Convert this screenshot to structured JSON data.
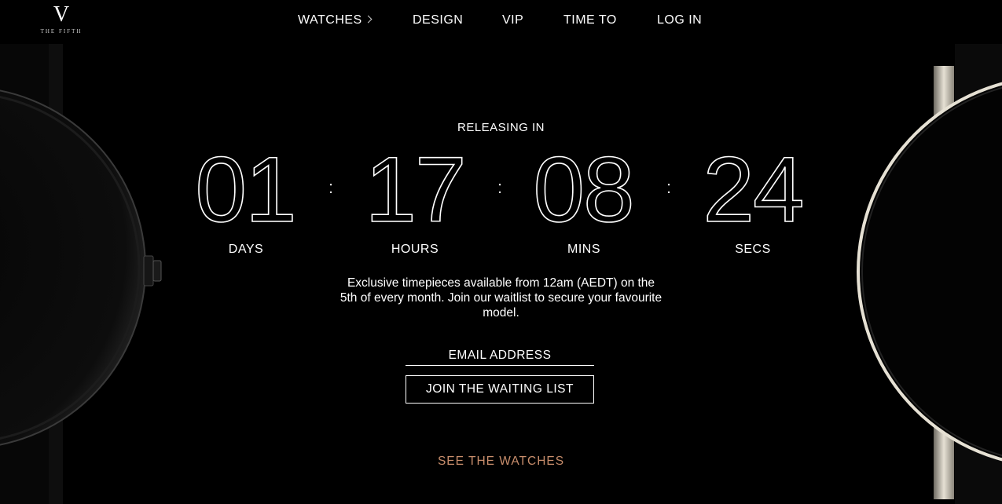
{
  "brand": {
    "logo_mark": "V",
    "logo_text": "THE FIFTH"
  },
  "nav": {
    "items": [
      {
        "label": "WATCHES",
        "has_submenu": true
      },
      {
        "label": "DESIGN"
      },
      {
        "label": "VIP"
      },
      {
        "label": "TIME TO"
      },
      {
        "label": "LOG IN"
      }
    ]
  },
  "countdown": {
    "heading": "RELEASING IN",
    "separator": ":",
    "units": [
      {
        "value": "01",
        "label": "DAYS"
      },
      {
        "value": "17",
        "label": "HOURS"
      },
      {
        "value": "08",
        "label": "MINS"
      },
      {
        "value": "24",
        "label": "SECS"
      }
    ]
  },
  "description": "Exclusive timepieces available from 12am (AEDT) on the 5th of every month. Join our waitlist to secure your favourite model.",
  "signup": {
    "email_placeholder": "EMAIL ADDRESS",
    "email_value": "",
    "button_label": "JOIN THE WAITING LIST"
  },
  "cta": {
    "see_watches": "SEE THE WATCHES"
  },
  "colors": {
    "background": "#000000",
    "text": "#ffffff",
    "accent": "#c98e6c"
  }
}
